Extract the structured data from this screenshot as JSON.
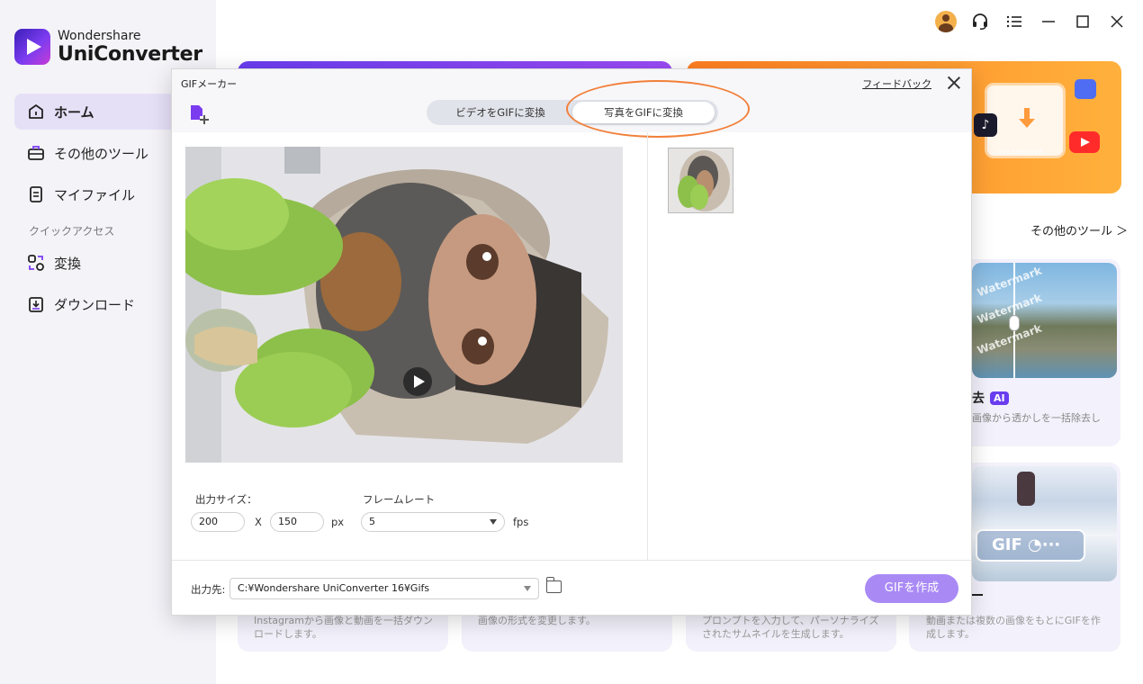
{
  "app": {
    "brand_small": "Wondershare",
    "brand_big": "UniConverter"
  },
  "sidebar": {
    "items": [
      {
        "label": "ホーム",
        "icon": "home-icon"
      },
      {
        "label": "その他のツール",
        "icon": "toolbox-icon"
      },
      {
        "label": "マイファイル",
        "icon": "file-icon"
      }
    ],
    "section_label": "クイックアクセス",
    "quick_items": [
      {
        "label": "変換",
        "icon": "convert-icon"
      },
      {
        "label": "ダウンロード",
        "icon": "download-icon"
      }
    ]
  },
  "main": {
    "more_tools": "その他のツール ＞",
    "banner_url": "xyz.com/xyz",
    "card1": {
      "title": "去",
      "badge": "AI",
      "desc": "画像から透かしを一括除去し",
      "watermark": "Watermark"
    },
    "card2": {
      "title": "ー",
      "gif_label": "GIF"
    },
    "bottom_cards": [
      "Instagramから画像と動画を一括ダウンロードします。",
      "画像の形式を変更します。",
      "プロンプトを入力して、パーソナライズされたサムネイルを生成します。",
      "動画または複数の画像をもとにGIFを作成します。"
    ]
  },
  "dialog": {
    "title": "GIFメーカー",
    "feedback": "フィードバック",
    "tabs": [
      "ビデオをGIFに変換",
      "写真をGIFに変換"
    ],
    "active_tab": 1,
    "output_size_label": "出力サイズ：",
    "width": "200",
    "x_label": "X",
    "height": "150",
    "px_label": "px",
    "frame_rate_label": "フレームレート",
    "frame_rate": "5",
    "fps_label": "fps",
    "output_dest_label": "出力先:",
    "output_path": "C:¥Wondershare UniConverter 16¥Gifs",
    "create_button": "GIFを作成"
  },
  "colors": {
    "accent": "#6a3df0",
    "create_button": "#a98af5",
    "highlight_ring": "#f2803a",
    "banner_orange": "#ff9b3c"
  }
}
